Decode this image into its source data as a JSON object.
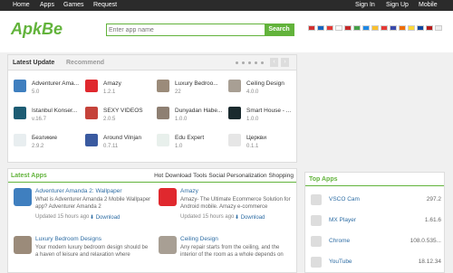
{
  "topbar": {
    "home": "Home",
    "apps": "Apps",
    "games": "Games",
    "request": "Request",
    "sign_in": "Sign In",
    "sign_up": "Sign Up",
    "mobile": "Mobile"
  },
  "header": {
    "logo": "ApkBe",
    "search_placeholder": "Enter app name",
    "search_button": "Search"
  },
  "flags": [
    "#d32f2f",
    "#1565c0",
    "#e53935",
    "#fafafa",
    "#c62828",
    "#43a047",
    "#1e88e5",
    "#fbc02d",
    "#e53935",
    "#3949ab",
    "#ef6c00",
    "#fdd835",
    "#0d47a1",
    "#b71c1c",
    "#eeeeee"
  ],
  "latest_update": {
    "tab_active": "Latest Update",
    "tab_inactive": "Recommend",
    "prev": "‹",
    "next": "›",
    "apps": [
      {
        "name": "Adventurer Ama...",
        "ver": "5.0",
        "color": "#3f7fbf"
      },
      {
        "name": "Amazy",
        "ver": "1.2.1",
        "color": "#e0282e"
      },
      {
        "name": "Luxury Bedroo...",
        "ver": "22",
        "color": "#9b8b7a"
      },
      {
        "name": "Ceiling Design",
        "ver": "4.0.0",
        "color": "#a89f94"
      },
      {
        "name": "Istanbul Konser...",
        "ver": "v.16.7",
        "color": "#1d5c73"
      },
      {
        "name": "SEXY VIDEOS",
        "ver": "2.0.5",
        "color": "#c5423a"
      },
      {
        "name": "Dunyadan Habe...",
        "ver": "1.0.0",
        "color": "#8e7f72"
      },
      {
        "name": "Smart House - ...",
        "ver": "1.0.0",
        "color": "#1a2a2e"
      },
      {
        "name": "Безликие",
        "ver": "2.9.2",
        "color": "#e8eef0"
      },
      {
        "name": "Around Vilnjan",
        "ver": "0.7.11",
        "color": "#3a5aa0"
      },
      {
        "name": "Edu Expert",
        "ver": "1.0",
        "color": "#e8f0ec"
      },
      {
        "name": "Церкви",
        "ver": "0.1.1",
        "color": "#e6e6e6"
      }
    ]
  },
  "latest_apps": {
    "title": "Latest Apps",
    "categories": [
      "Hot",
      "Download",
      "Tools",
      "Social",
      "Personalization",
      "Shopping"
    ],
    "items": [
      {
        "title": "Adventurer Amanda 2: Wallpaper",
        "desc": "What is Adventurer Amanda 2 Mobile Wallpaper app? Adventurer Amanda 2",
        "updated": "Updated 15 hours ago",
        "download": "⬇ Download",
        "color": "#3f7fbf"
      },
      {
        "title": "Amazy",
        "desc": "Amazy- The Ultimate Ecommerce Solution for Android mobile. Amazy e-commerce",
        "updated": "Updated 15 hours ago",
        "download": "⬇ Download",
        "color": "#e0282e"
      },
      {
        "title": "Luxury Bedroom Designs",
        "desc": "Your modern luxury bedroom design should be a haven of leisure and relaxation where",
        "updated": "",
        "download": "",
        "color": "#9b8b7a"
      },
      {
        "title": "Ceiling Design",
        "desc": "Any repair starts from the ceiling, and the interior of the room as a whole depends on",
        "updated": "",
        "download": "",
        "color": "#a89f94"
      }
    ]
  },
  "top_apps": {
    "title": "Top Apps",
    "items": [
      {
        "name": "VSCO Cam",
        "value": "297.2"
      },
      {
        "name": "MX Player",
        "value": "1.61.6"
      },
      {
        "name": "Chrome",
        "value": "108.0.535..."
      },
      {
        "name": "YouTube",
        "value": "18.12.34"
      }
    ]
  }
}
